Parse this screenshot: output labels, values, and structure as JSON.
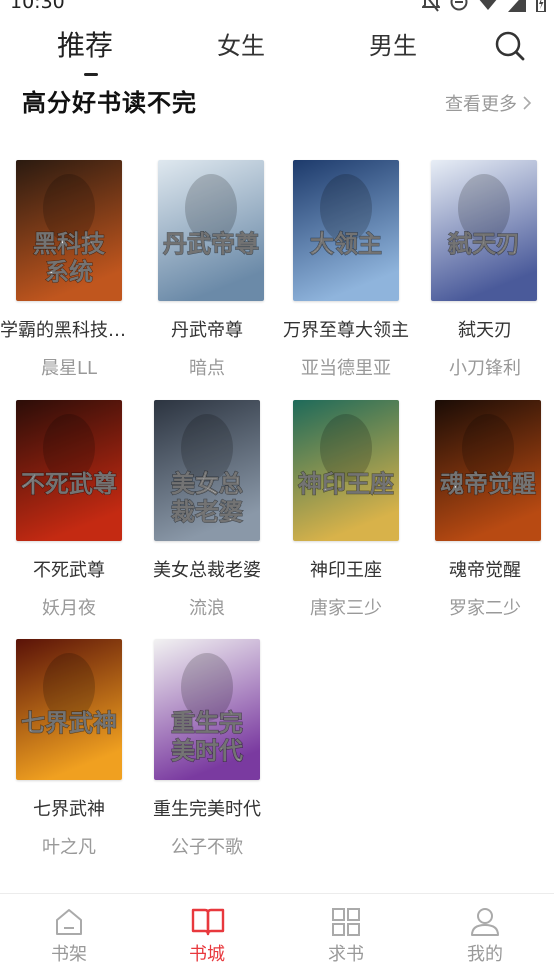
{
  "status_bar": {
    "time": "10:30"
  },
  "top_tabs": [
    {
      "label": "推荐"
    },
    {
      "label": "女生"
    },
    {
      "label": "男生"
    }
  ],
  "section": {
    "title": "高分好书读不完",
    "more_label": "查看更多"
  },
  "books": [
    {
      "title": "学霸的黑科技系统",
      "author": "晨星LL",
      "cover_text": "黑科技系统",
      "cover_colors": [
        "#2a1a10",
        "#c0561e"
      ]
    },
    {
      "title": "丹武帝尊",
      "author": "暗点",
      "cover_text": "丹武帝尊",
      "cover_colors": [
        "#dfe8ef",
        "#6b8aa8"
      ]
    },
    {
      "title": "万界至尊大领主",
      "author": "亚当德里亚",
      "cover_text": "大领主",
      "cover_colors": [
        "#1d3a6b",
        "#8fb4dc"
      ]
    },
    {
      "title": "弑天刃",
      "author": "小刀锋利",
      "cover_text": "弑天刃",
      "cover_colors": [
        "#e8eef6",
        "#4a5a9a"
      ]
    },
    {
      "title": "不死武尊",
      "author": "妖月夜",
      "cover_text": "不死武尊",
      "cover_colors": [
        "#2b0d08",
        "#c42a12"
      ]
    },
    {
      "title": "美女总裁老婆",
      "author": "流浪",
      "cover_text": "美女总裁老婆",
      "cover_colors": [
        "#2c3440",
        "#8a98a8"
      ]
    },
    {
      "title": "神印王座",
      "author": "唐家三少",
      "cover_text": "神印王座",
      "cover_colors": [
        "#1e6a5a",
        "#d8b24a"
      ]
    },
    {
      "title": "魂帝觉醒",
      "author": "罗家二少",
      "cover_text": "魂帝觉醒",
      "cover_colors": [
        "#1a0c06",
        "#b84a12"
      ]
    },
    {
      "title": "七界武神",
      "author": "叶之凡",
      "cover_text": "七界武神",
      "cover_colors": [
        "#5a1208",
        "#f0a020"
      ]
    },
    {
      "title": "重生完美时代",
      "author": "公子不歌",
      "cover_text": "重生完美时代",
      "cover_colors": [
        "#f2f2f2",
        "#7a3aa0"
      ]
    }
  ],
  "bottom_nav": [
    {
      "label": "书架",
      "icon": "home-icon"
    },
    {
      "label": "书城",
      "icon": "book-icon",
      "active": true
    },
    {
      "label": "求书",
      "icon": "grid-icon"
    },
    {
      "label": "我的",
      "icon": "user-icon"
    }
  ],
  "colors": {
    "accent": "#e8383d",
    "muted": "#999999",
    "text": "#333333"
  }
}
